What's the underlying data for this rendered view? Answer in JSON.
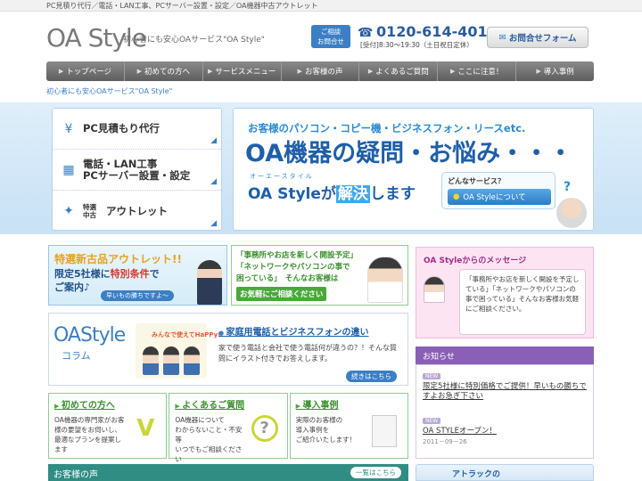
{
  "top_strip": "PC見積り代行／電話・LAN工事、PCサーバー設置・設定／OA機器中古アウトレット",
  "header": {
    "logo": "OA Style",
    "tagline": "初心者にも安心OAサービス\"OA Style\"",
    "contact_badge": "ご相談\nお問合せ",
    "phone": "0120-614-401",
    "hours": "[受付]8:30～19:30（土日祝日定休）",
    "form_button": "お問合せフォーム"
  },
  "nav": {
    "items": [
      "トップページ",
      "初めての方へ",
      "サービスメニュー",
      "お客様の声",
      "よくあるご質問",
      "ここに注意！",
      "導入事例"
    ]
  },
  "breadcrumb": "初心者にも安心OAサービス\"OA Style\"",
  "services": [
    {
      "label": "PC見積もり代行",
      "icon": "yen-icon"
    },
    {
      "label": "電話・LAN工事\nPCサーバー設置・設定",
      "icon": "phone-grid-icon"
    },
    {
      "prefix": "特選\n中古",
      "label": "アウトレット",
      "icon": "sparkle-icon"
    }
  ],
  "hero": {
    "sub": "お客様のパソコン・コピー機・ビジネスフォン・リースetc.",
    "title": "OA機器の疑問・お悩み・・・",
    "kana": "オーエースタイル",
    "solve_pre": "OA Styleが",
    "solve_hl": "解決",
    "solve_post": "します",
    "q_label": "どんなサービス？",
    "q_button": "OA Styleについて"
  },
  "outlet_banner": {
    "title": "特選新古品アウトレット!!",
    "line1_pre": "限定5社様に",
    "line1_em": "特別条件",
    "line1_post": "で",
    "line2": "ご案内♪",
    "button": "早いもの勝ちですよ～"
  },
  "consult_banner": {
    "line1": "「事務所やお店を新しく開設予定」",
    "line2": "「ネットワークやパソコンの事で",
    "line3": "困っている」　そんなお客様は",
    "button": "お気軽にご相談ください"
  },
  "column": {
    "logo": "OAStyle",
    "sub": "コラム",
    "happy": "みんなで使えてHaPPy!",
    "link": "家庭用電話とビジネスフォンの違い",
    "desc": "家で使う電話と会社で使う電話何が違うの？！そんな質問にイラスト付きでお答えします。",
    "more": "続きはこちら"
  },
  "cards": [
    {
      "title": "初めての方へ",
      "text": "OA機器の専門家がお客様の要望をお伺いし、最適なプランを提案します",
      "art": "check-icon"
    },
    {
      "title": "よくあるご質問",
      "text": "OA機器について\nわからないこと・不安等\nいつでもご相談ください",
      "art": "question-icon"
    },
    {
      "title": "導入事例",
      "text": "実際のお客様の\n導入事例を\nご紹介いたします！",
      "art": "document-icon"
    }
  ],
  "voice": {
    "title": "お客様の声",
    "button": "一覧はこちら"
  },
  "message": {
    "head": "OA Styleからのメッセージ",
    "body": "「事務所やお店を新しく開設を予定している」「ネットワークやパソコンの事で困っている」そんなお客様お気軽にご相談ください。"
  },
  "news": {
    "head": "お知らせ",
    "items": [
      {
        "badge": "NEW",
        "title": "限定5社様に特別価格でご提供！早いもの勝ちですよお急ぎ下さい",
        "date": ""
      },
      {
        "badge": "NEW",
        "title": "OA STYLEオープン！",
        "date": "2011－09－26"
      }
    ]
  },
  "attraction": "アトラックの"
}
